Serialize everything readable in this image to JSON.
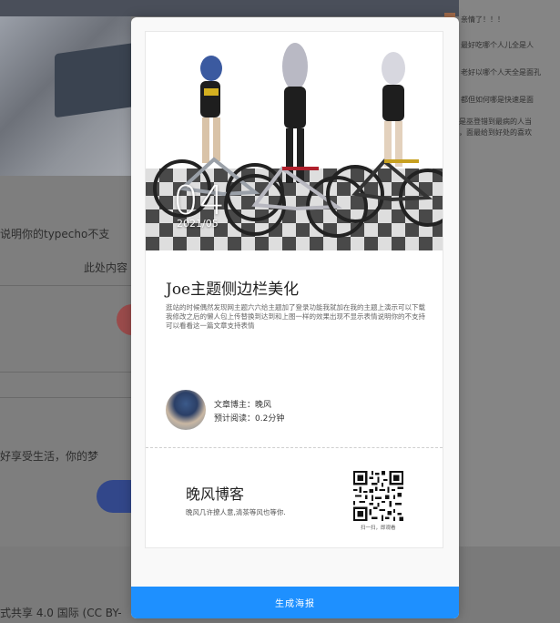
{
  "background": {
    "left_text_1": "说明你的typecho不支",
    "left_text_2": "此处内容",
    "left_text_3": "好享受生活，你的梦",
    "right_items": [
      "亲情了！！！",
      "最好吃哪个人儿全是人",
      "老好以哪个人天全是面孔",
      "都但如何哪是快速是面",
      "是巫登错到最病的人当",
      "，面最给到好处的喜欢"
    ],
    "footer_text": "式共享 4.0 国际 (CC BY-"
  },
  "poster": {
    "day": "04",
    "date": "2021/05",
    "title": "Joe主题侧边栏美化",
    "excerpt": "逛站的时候偶然发现网主题六六给主题加了登录功能我就加在我的主题上演示可以下载我修改之后的懒人包上传替换到达到和上图一样的效果出现不显示表情说明你的不支持可以看看这一篇文章支持表情",
    "author_label": "文章博主：晚风",
    "read_time_label": "预计阅读：0.2分钟",
    "blog_name": "晚风博客",
    "blog_slogan": "晚风几许撩人意,清茶等风也等你.",
    "qr_caption": "扫一扫，即观看"
  },
  "actions": {
    "generate_label": "生成海报"
  },
  "colors": {
    "primary_button": "#1e90ff",
    "overlay": "#7c7c7c"
  }
}
